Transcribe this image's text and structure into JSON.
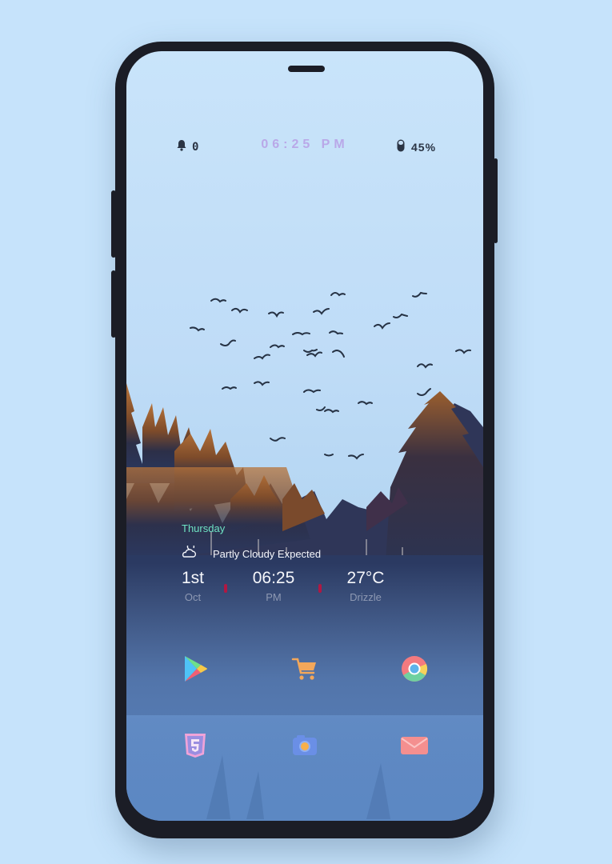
{
  "status_bar": {
    "notification_count": "0",
    "clock": "06:25 PM",
    "battery": "45%",
    "bell_icon": "bell-icon",
    "battery_icon": "battery-icon"
  },
  "widget": {
    "day": "Thursday",
    "weather_icon": "partly-cloudy-icon",
    "forecast": "Partly Cloudy Expected",
    "date": {
      "main": "1st",
      "sub": "Oct"
    },
    "time": {
      "main": "06:25",
      "sub": "PM"
    },
    "temperature": {
      "main": "27°C",
      "sub": "Drizzle"
    }
  },
  "apps": [
    {
      "name": "play-store-icon"
    },
    {
      "name": "shopping-cart-icon"
    },
    {
      "name": "chrome-icon"
    },
    {
      "name": "html5-icon"
    },
    {
      "name": "camera-icon"
    },
    {
      "name": "mail-icon"
    }
  ],
  "colors": {
    "background": "#c6e3fb",
    "clock": "#b9a8e8",
    "day": "#6ee3c4",
    "divider": "#b01843"
  }
}
